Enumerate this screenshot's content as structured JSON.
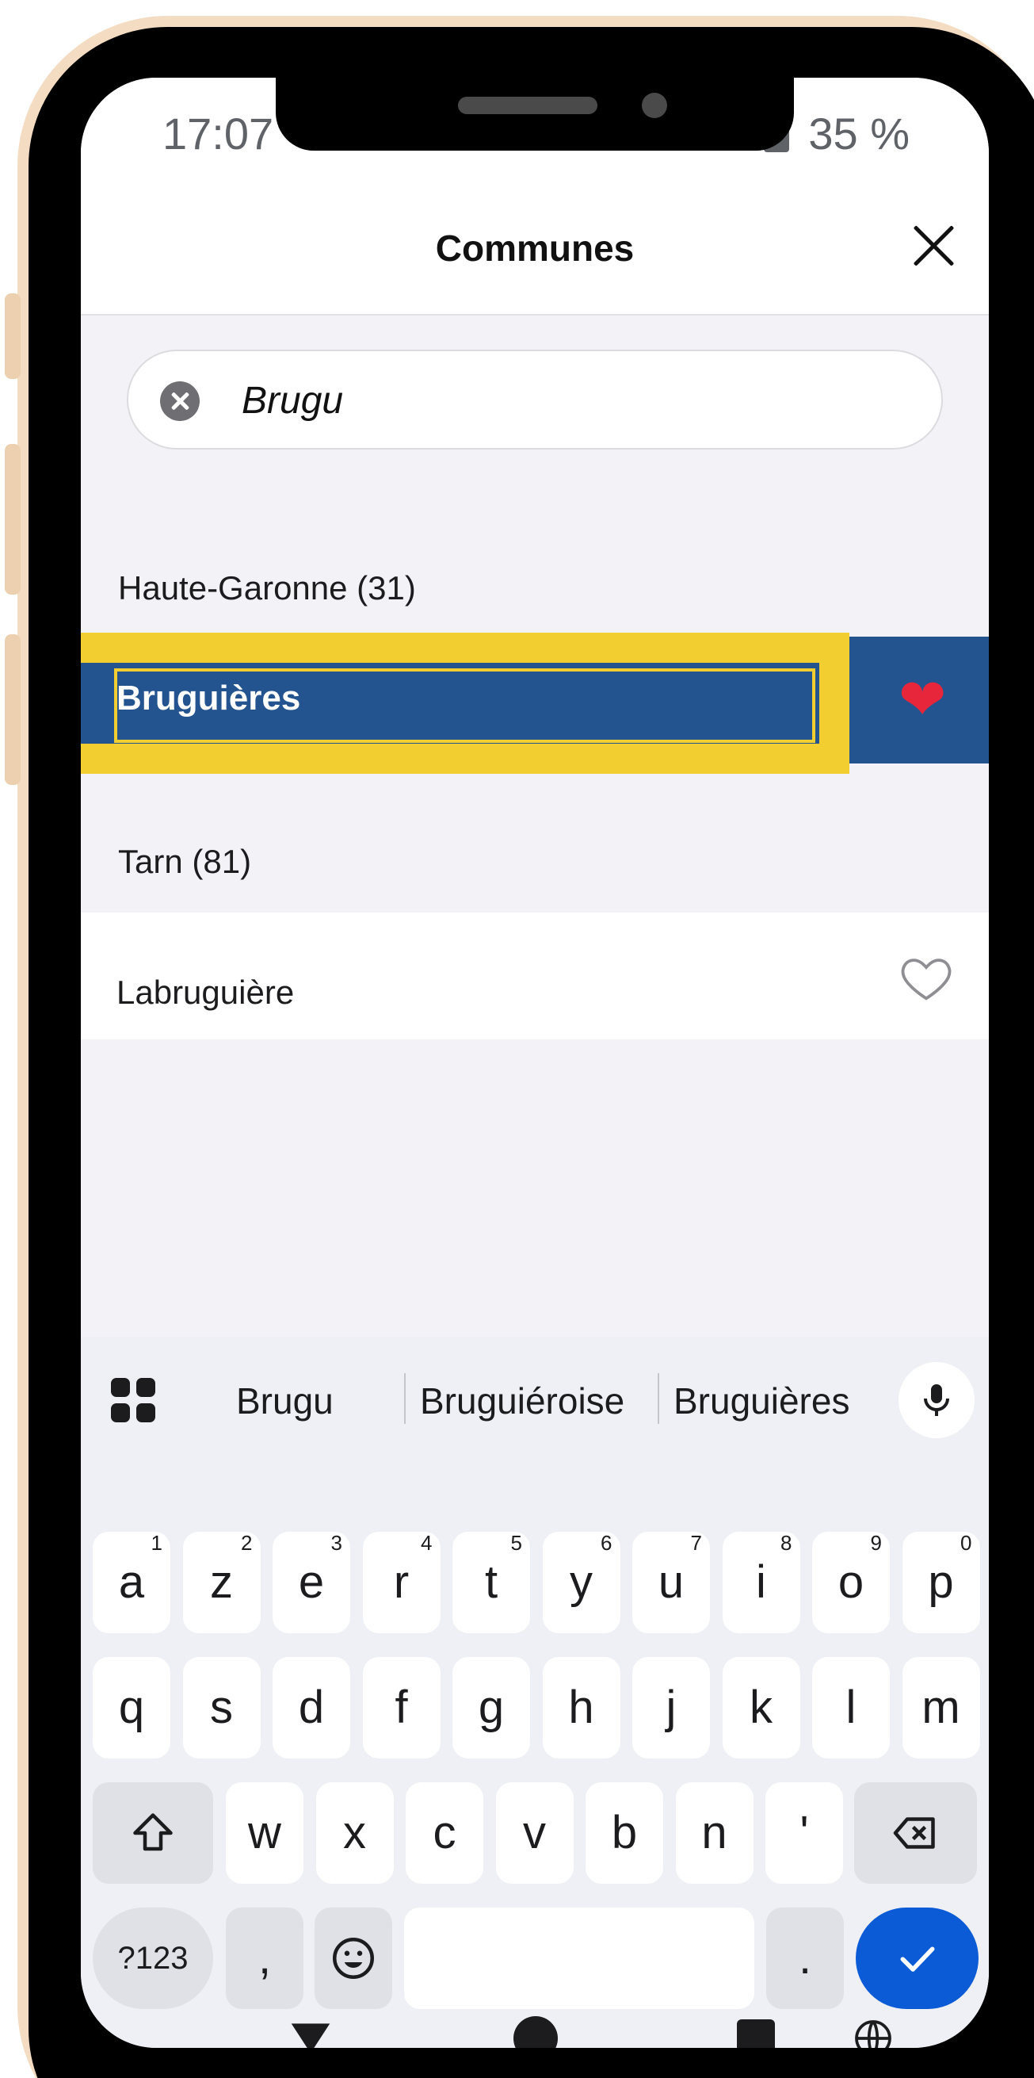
{
  "status": {
    "time": "17:07",
    "battery": "35 %"
  },
  "header": {
    "title": "Communes"
  },
  "search": {
    "value": "Brugu"
  },
  "results": [
    {
      "section": "Haute-Garonne (31)",
      "name": "Bruguières",
      "favorite": true
    },
    {
      "section": "Tarn (81)",
      "name": "Labruguière",
      "favorite": false
    }
  ],
  "keyboard": {
    "suggestions": [
      "Brugu",
      "Bruguiéroise",
      "Bruguières"
    ],
    "row1": [
      "a",
      "z",
      "e",
      "r",
      "t",
      "y",
      "u",
      "i",
      "o",
      "p"
    ],
    "row1_hints": [
      "1",
      "2",
      "3",
      "4",
      "5",
      "6",
      "7",
      "8",
      "9",
      "0"
    ],
    "row2": [
      "q",
      "s",
      "d",
      "f",
      "g",
      "h",
      "j",
      "k",
      "l",
      "m"
    ],
    "row3": [
      "w",
      "x",
      "c",
      "v",
      "b",
      "n",
      "'"
    ],
    "symbols": "?123",
    "comma": ",",
    "period": "."
  },
  "colors": {
    "selected_row": "#24548f",
    "highlight": "#f2ce30",
    "heart": "#e8263b",
    "enter_key": "#0b5ad6"
  }
}
